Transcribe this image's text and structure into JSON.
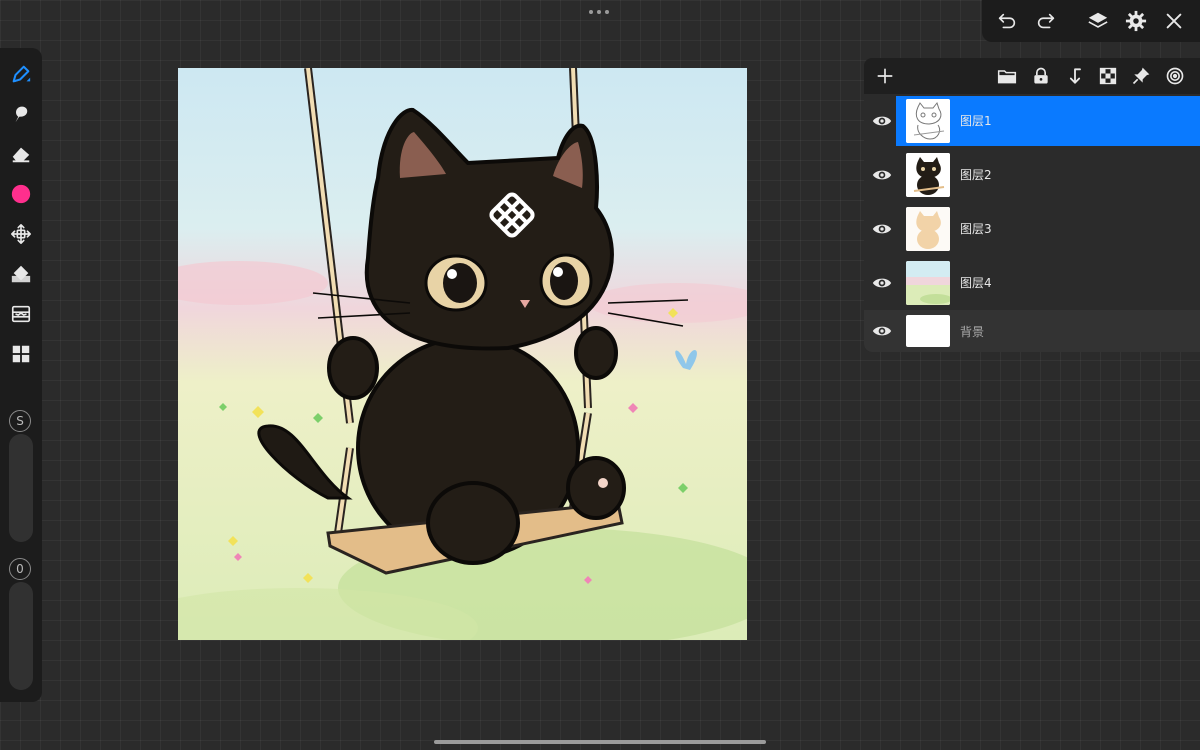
{
  "app": {
    "more_menu_icon": "ellipsis-icon"
  },
  "toolbar": {
    "tools": [
      {
        "name": "brush-tool",
        "icon": "brush-icon",
        "active": true
      },
      {
        "name": "smudge-tool",
        "icon": "smudge-icon"
      },
      {
        "name": "eraser-tool",
        "icon": "eraser-icon"
      },
      {
        "name": "color-picker",
        "icon": "color-swatch-icon",
        "color": "#ff2f8d"
      },
      {
        "name": "transform-tool",
        "icon": "move-arrows-icon"
      },
      {
        "name": "fill-tool",
        "icon": "paint-bucket-icon"
      },
      {
        "name": "adjustments-tool",
        "icon": "adjustments-icon"
      },
      {
        "name": "gallery-tool",
        "icon": "grid-icon"
      }
    ],
    "size_badge": "S",
    "opacity_badge": "0"
  },
  "topbar": {
    "undo_icon": "undo-icon",
    "redo_icon": "redo-icon",
    "layers_icon": "layers-icon",
    "settings_icon": "gear-icon",
    "close_icon": "close-icon"
  },
  "layers_panel": {
    "header_icons": [
      "plus-icon",
      "folder-icon",
      "lock-icon",
      "merge-down-icon",
      "checkerboard-icon",
      "pin-icon",
      "spiral-icon"
    ],
    "layers": [
      {
        "name": "图层1",
        "visible": true,
        "selected": true
      },
      {
        "name": "图层2",
        "visible": true,
        "selected": false
      },
      {
        "name": "图层3",
        "visible": true,
        "selected": false
      },
      {
        "name": "图层4",
        "visible": true,
        "selected": false
      }
    ],
    "background": {
      "name": "背景",
      "visible": true
    }
  },
  "colors": {
    "accent": "#0a7aff",
    "active_tool": "#1e8fff",
    "current_color": "#ff2f8d"
  }
}
